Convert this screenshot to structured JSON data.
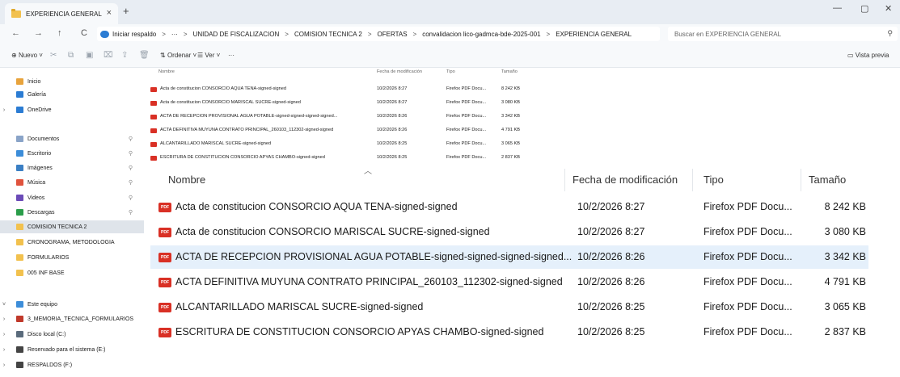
{
  "window": {
    "tab_title": "EXPERIENCIA GENERAL",
    "tab_close": "×",
    "new_tab": "+",
    "minimize": "—",
    "restore": "▢",
    "close": "✕"
  },
  "nav": {
    "back": "←",
    "forward": "→",
    "up": "↑",
    "refresh": "C"
  },
  "address": {
    "backup_label": "Iniciar respaldo",
    "more": "···",
    "breadcrumbs": [
      "UNIDAD DE FISCALIZACION",
      "COMISION TECNICA 2",
      "OFERTAS",
      "convalidacion lico-gadmca-bde-2025-001",
      "EXPERIENCIA GENERAL"
    ],
    "separator": ">"
  },
  "search": {
    "placeholder": "Buscar en EXPERIENCIA GENERAL"
  },
  "commands": {
    "new": "Nuevo",
    "sort": "Ordenar",
    "view": "Ver",
    "more": "···",
    "preview": "Vista previa"
  },
  "sidebar": {
    "items": [
      {
        "label": "Inicio",
        "icon": "home-icon",
        "color": "#e8a33c"
      },
      {
        "label": "Galería",
        "icon": "gallery-icon",
        "color": "#2b7cd3"
      },
      {
        "label": "OneDrive",
        "icon": "cloud-icon",
        "color": "#2b7cd3"
      },
      {
        "label": "Documentos",
        "icon": "documents-icon",
        "color": "#8aa4c8"
      },
      {
        "label": "Escritorio",
        "icon": "desktop-icon",
        "color": "#3c8dd9"
      },
      {
        "label": "Imágenes",
        "icon": "pictures-icon",
        "color": "#3a7fc4"
      },
      {
        "label": "Música",
        "icon": "music-icon",
        "color": "#e0533d"
      },
      {
        "label": "Videos",
        "icon": "videos-icon",
        "color": "#6b4bb8"
      },
      {
        "label": "Descargas",
        "icon": "downloads-icon",
        "color": "#2a9d4a"
      },
      {
        "label": "COMISION TECNICA 2",
        "icon": "folder-icon",
        "color": "#f2c14e"
      },
      {
        "label": "CRONOGRAMA, METODOLOGIA",
        "icon": "folder-icon",
        "color": "#f2c14e"
      },
      {
        "label": "FORMULARIOS",
        "icon": "folder-icon",
        "color": "#f2c14e"
      },
      {
        "label": "005 INF BASE",
        "icon": "folder-icon",
        "color": "#f2c14e"
      },
      {
        "label": "Este equipo",
        "icon": "computer-icon",
        "color": "#3c8dd9"
      },
      {
        "label": "3_MEMORIA_TECNICA_FORMULARIOS",
        "icon": "archive-icon",
        "color": "#c0392b"
      },
      {
        "label": "Disco local (C:)",
        "icon": "drive-icon",
        "color": "#5a6b7c"
      },
      {
        "label": "Reservado para el sistema (E:)",
        "icon": "drive-icon",
        "color": "#444444"
      },
      {
        "label": "RESPALDOS (F:)",
        "icon": "drive-icon",
        "color": "#444444"
      }
    ]
  },
  "columns": {
    "name": "Nombre",
    "modified": "Fecha de modificación",
    "type": "Tipo",
    "size": "Tamaño"
  },
  "files": [
    {
      "name": "Acta de constitucion CONSORCIO AQUA TENA-signed-signed",
      "modified": "10/2/2026 8:27",
      "type": "Firefox PDF Docu...",
      "size": "8 242 KB"
    },
    {
      "name": "Acta de constitucion CONSORCIO MARISCAL SUCRE-signed-signed",
      "modified": "10/2/2026 8:27",
      "type": "Firefox PDF Docu...",
      "size": "3 080 KB"
    },
    {
      "name": "ACTA DE RECEPCION PROVISIONAL AGUA POTABLE-signed-signed-signed-signed...",
      "modified": "10/2/2026 8:26",
      "type": "Firefox PDF Docu...",
      "size": "3 342 KB"
    },
    {
      "name": "ACTA DEFINITIVA MUYUNA CONTRATO PRINCIPAL_260103_112302-signed-signed",
      "modified": "10/2/2026 8:26",
      "type": "Firefox PDF Docu...",
      "size": "4 791 KB"
    },
    {
      "name": "ALCANTARILLADO MARISCAL SUCRE-signed-signed",
      "modified": "10/2/2026 8:25",
      "type": "Firefox PDF Docu...",
      "size": "3 065 KB"
    },
    {
      "name": "ESCRITURA DE CONSTITUCION CONSORCIO APYAS CHAMBO-signed-signed",
      "modified": "10/2/2026 8:25",
      "type": "Firefox PDF Docu...",
      "size": "2 837 KB"
    }
  ],
  "mini_files": [
    {
      "name": "Acta de constitucion CONSORCIO AQUA TENA-signed-signed",
      "modified": "10/2/2026 8:27",
      "type": "Firefox PDF Docu...",
      "size": "8 242 KB"
    },
    {
      "name": "Acta de constitucion CONSORCIO MARISCAL SUCRE-signed-signed",
      "modified": "10/2/2026 8:27",
      "type": "Firefox PDF Docu...",
      "size": "3 080 KB"
    },
    {
      "name": "ACTA DE RECEPCION PROVISIONAL AGUA POTABLE-signed-signed-signed-signed...",
      "modified": "10/2/2026 8:26",
      "type": "Firefox PDF Docu...",
      "size": "3 342 KB"
    },
    {
      "name": "ACTA DEFINITIVA MUYUNA CONTRATO PRINCIPAL_260103_112302-signed-signed",
      "modified": "10/2/2026 8:26",
      "type": "Firefox PDF Docu...",
      "size": "4 791 KB"
    },
    {
      "name": "ALCANTARILLADO MARISCAL SUCRE-signed-signed",
      "modified": "10/2/2026 8:25",
      "type": "Firefox PDF Docu...",
      "size": "3 065 KB"
    },
    {
      "name": "ESCRITURA DE CONSTITUCION CONSORCIO APYAS CHAMBO-signed-signed",
      "modified": "10/2/2026 8:25",
      "type": "Firefox PDF Docu...",
      "size": "2 837 KB"
    }
  ],
  "pdf_badge": "PDF",
  "colors": {
    "accent": "#2b7cd3",
    "hover_row": "#e5f0fb",
    "pdf_red": "#d93025"
  }
}
